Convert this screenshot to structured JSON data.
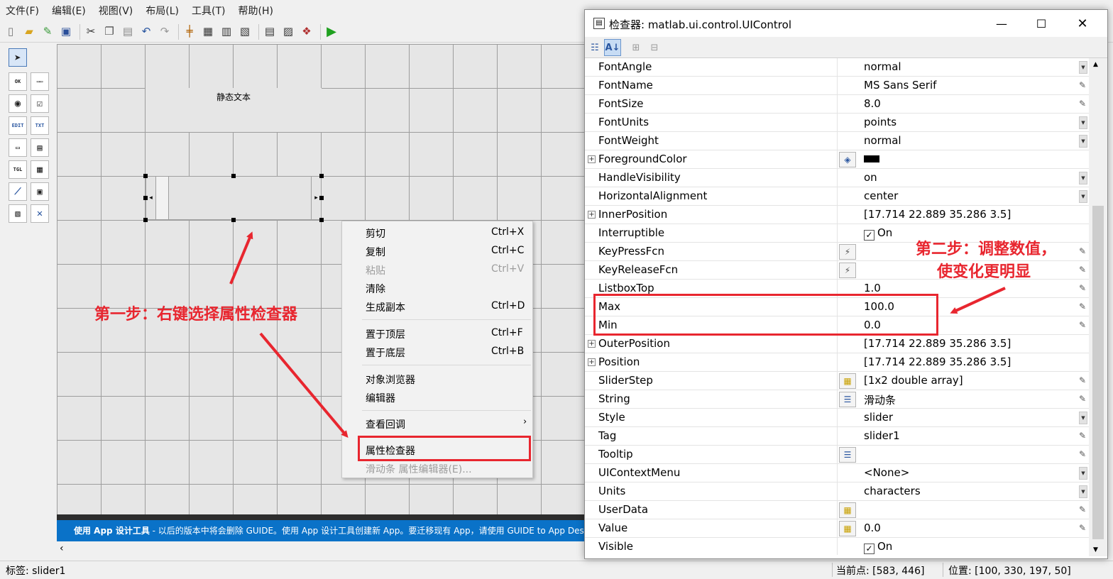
{
  "menu": [
    "文件(F)",
    "编辑(E)",
    "视图(V)",
    "布局(L)",
    "工具(T)",
    "帮助(H)"
  ],
  "toolbar_icons": [
    "new-file-icon",
    "open-folder-icon",
    "edit-icon",
    "save-icon",
    "cut-icon",
    "copy-icon",
    "paste-icon",
    "undo-icon",
    "redo-icon",
    "align-icon",
    "menu-editor-icon",
    "tab-order-icon",
    "toolbar-editor-icon",
    "editor-icon",
    "inspector-icon",
    "object-browser-icon",
    "run-icon"
  ],
  "canvas": {
    "static_text": "静态文本"
  },
  "notice": {
    "bold": "使用 App 设计工具",
    "text": " - 以后的版本中将会删除 GUIDE。使用 App 设计工具创建新 App。要迁移现有 App，请使用 GUIDE to App Designer"
  },
  "status": {
    "tag": "标签: slider1",
    "current_point": "当前点:  [583, 446]",
    "position": "位置: [100, 330, 197, 50]"
  },
  "context_menu": {
    "items": [
      {
        "label": "剪切",
        "shortcut": "Ctrl+X",
        "enabled": true
      },
      {
        "label": "复制",
        "shortcut": "Ctrl+C",
        "enabled": true
      },
      {
        "label": "粘贴",
        "shortcut": "Ctrl+V",
        "enabled": false
      },
      {
        "label": "清除",
        "shortcut": "",
        "enabled": true
      },
      {
        "label": "生成副本",
        "shortcut": "Ctrl+D",
        "enabled": true
      },
      {
        "label": "置于顶层",
        "shortcut": "Ctrl+F",
        "enabled": true
      },
      {
        "label": "置于底层",
        "shortcut": "Ctrl+B",
        "enabled": true
      },
      {
        "label": "对象浏览器",
        "shortcut": "",
        "enabled": true
      },
      {
        "label": "编辑器",
        "shortcut": "",
        "enabled": true
      },
      {
        "label": "查看回调",
        "shortcut": "",
        "enabled": true
      },
      {
        "label": "属性检查器",
        "shortcut": "",
        "enabled": true
      },
      {
        "label": "滑动条 属性编辑器(E)...",
        "shortcut": "",
        "enabled": false
      }
    ]
  },
  "inspector": {
    "title": "检查器:  matlab.ui.control.UIControl",
    "rows": [
      {
        "name": "FontAngle",
        "value": "normal",
        "ctrl": "drop"
      },
      {
        "name": "FontName",
        "value": "MS Sans Serif",
        "ctrl": "edit"
      },
      {
        "name": "FontSize",
        "value": "8.0",
        "ctrl": "edit"
      },
      {
        "name": "FontUnits",
        "value": "points",
        "ctrl": "drop"
      },
      {
        "name": "FontWeight",
        "value": "normal",
        "ctrl": "drop"
      },
      {
        "name": "ForegroundColor",
        "value": "",
        "ctrl": "none",
        "expand": true,
        "button": "color",
        "swatch": true
      },
      {
        "name": "HandleVisibility",
        "value": "on",
        "ctrl": "drop"
      },
      {
        "name": "HorizontalAlignment",
        "value": "center",
        "ctrl": "drop"
      },
      {
        "name": "InnerPosition",
        "value": "[17.714 22.889 35.286 3.5]",
        "ctrl": "none",
        "expand": true
      },
      {
        "name": "Interruptible",
        "value": "On",
        "ctrl": "none",
        "check": true
      },
      {
        "name": "KeyPressFcn",
        "value": "",
        "ctrl": "edit",
        "button": "callback"
      },
      {
        "name": "KeyReleaseFcn",
        "value": "",
        "ctrl": "edit",
        "button": "callback"
      },
      {
        "name": "ListboxTop",
        "value": "1.0",
        "ctrl": "edit"
      },
      {
        "name": "Max",
        "value": "100.0",
        "ctrl": "edit"
      },
      {
        "name": "Min",
        "value": "0.0",
        "ctrl": "edit"
      },
      {
        "name": "OuterPosition",
        "value": "[17.714 22.889 35.286 3.5]",
        "ctrl": "none",
        "expand": true
      },
      {
        "name": "Position",
        "value": "[17.714 22.889 35.286 3.5]",
        "ctrl": "none",
        "expand": true
      },
      {
        "name": "SliderStep",
        "value": "[1x2  double array]",
        "ctrl": "edit",
        "button": "array"
      },
      {
        "name": "String",
        "value": "滑动条",
        "ctrl": "edit",
        "button": "text"
      },
      {
        "name": "Style",
        "value": "slider",
        "ctrl": "drop"
      },
      {
        "name": "Tag",
        "value": "slider1",
        "ctrl": "edit"
      },
      {
        "name": "Tooltip",
        "value": "",
        "ctrl": "edit",
        "button": "text"
      },
      {
        "name": "UIContextMenu",
        "value": "<None>",
        "ctrl": "drop"
      },
      {
        "name": "Units",
        "value": "characters",
        "ctrl": "drop"
      },
      {
        "name": "UserData",
        "value": "",
        "ctrl": "edit",
        "button": "array"
      },
      {
        "name": "Value",
        "value": "0.0",
        "ctrl": "edit",
        "button": "array"
      },
      {
        "name": "Visible",
        "value": "On",
        "ctrl": "none",
        "check": true
      }
    ]
  },
  "annotations": {
    "step1": "第一步：右键选择属性检查器",
    "step2_line1": "第二步：调整数值，",
    "step2_line2": "使变化更明显",
    "color": "#e8262f"
  }
}
